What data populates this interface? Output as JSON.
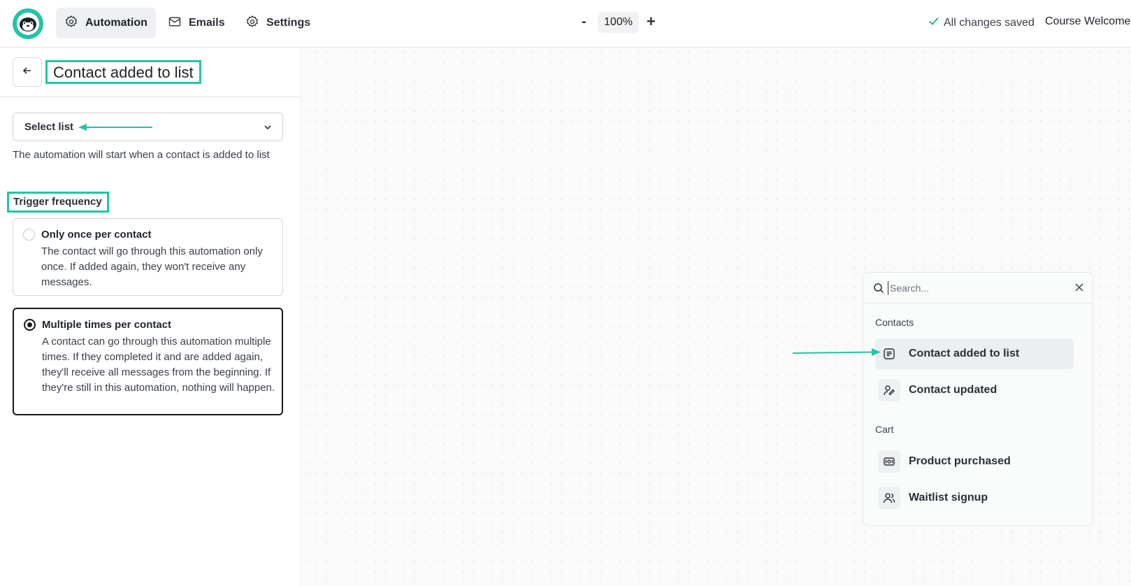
{
  "topbar": {
    "nav": [
      {
        "label": "Automation",
        "icon": "gear-icon",
        "active": true
      },
      {
        "label": "Emails",
        "icon": "mail-icon",
        "active": false
      },
      {
        "label": "Settings",
        "icon": "gear-icon",
        "active": false
      }
    ],
    "zoom": {
      "minus": "-",
      "value": "100%",
      "plus": "+"
    },
    "save_status": "All changes saved",
    "course_title": "Course Welcome"
  },
  "panel": {
    "title": "Contact added to list",
    "select_placeholder": "Select list",
    "help_text": "The automation will start when a contact is added to list",
    "frequency_label": "Trigger frequency",
    "options": [
      {
        "title": "Only once per contact",
        "description": "The contact will go through this automation only once. If added again, they won't receive any messages.",
        "selected": false
      },
      {
        "title": "Multiple times per contact",
        "description": "A contact can go through this automation multiple times. If they completed it and are added again, they'll receive all messages from the beginning. If they're still in this automation, nothing will happen.",
        "selected": true
      }
    ]
  },
  "picker": {
    "search_placeholder": "Search...",
    "groups": [
      {
        "label": "Contacts",
        "items": [
          {
            "label": "Contact added to list",
            "icon": "list-icon",
            "highlighted": true
          },
          {
            "label": "Contact updated",
            "icon": "user-edit-icon",
            "highlighted": false
          }
        ]
      },
      {
        "label": "Cart",
        "items": [
          {
            "label": "Product purchased",
            "icon": "money-icon",
            "highlighted": false
          },
          {
            "label": "Waitlist signup",
            "icon": "users-icon",
            "highlighted": false
          }
        ]
      }
    ]
  },
  "colors": {
    "accent": "#22c6a3",
    "brand": "#23c4a4"
  }
}
